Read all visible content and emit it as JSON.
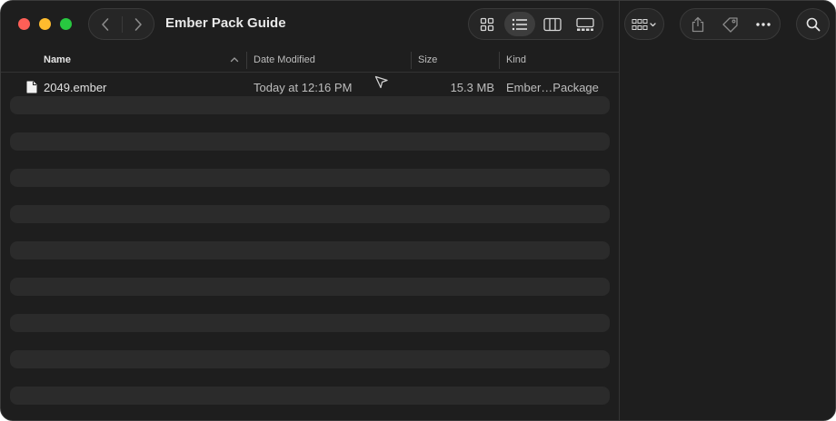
{
  "window": {
    "title": "Ember Pack Guide"
  },
  "toolbar": {
    "nav": [
      "back-icon",
      "forward-icon"
    ],
    "views": [
      "icon-view-icon",
      "list-view-icon",
      "column-view-icon",
      "gallery-view-icon"
    ],
    "active_view": "list",
    "actions": [
      "group-icon",
      "share-icon",
      "tag-icon",
      "more-icon",
      "search-icon"
    ]
  },
  "columns": {
    "name": "Name",
    "date": "Date Modified",
    "size": "Size",
    "kind": "Kind"
  },
  "files": [
    {
      "name": "2049.ember",
      "date": "Today at 12:16 PM",
      "size": "15.3 MB",
      "kind": "Ember…Package"
    }
  ],
  "colors": {
    "background": "#1e1e1e",
    "stripe": "#2b2b2b",
    "close": "#ff5f57",
    "minimize": "#febc2e",
    "zoom": "#28c840"
  }
}
